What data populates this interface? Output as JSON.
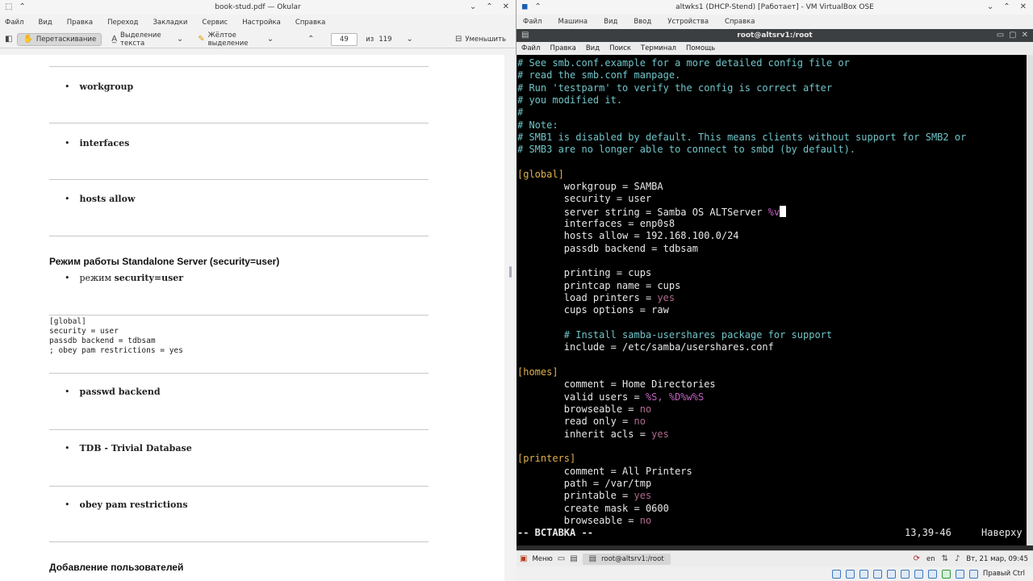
{
  "okular": {
    "title": "book-stud.pdf — Okular",
    "menu": [
      "Файл",
      "Вид",
      "Правка",
      "Переход",
      "Закладки",
      "Сервис",
      "Настройка",
      "Справка"
    ],
    "toolbar": {
      "drag": "Перетаскивание",
      "text_select": "Выделение текста",
      "highlight": "Жёлтое выделение",
      "page": "49",
      "of": "из",
      "total": "119",
      "zoom_out": "Уменьшить"
    },
    "doc": {
      "b_workgroup": "workgroup",
      "b_interfaces": "interfaces",
      "b_hosts": "hosts allow",
      "heading1": "Режим работы Standalone Server (security=user)",
      "b_mode_prefix": "режим",
      "b_mode_bold": "security=user",
      "code": [
        "[global]",
        "security = user",
        "passdb backend = tdbsam",
        "; obey pam restrictions = yes"
      ],
      "b_passwd": "passwd backend",
      "b_tdb": "TDB - Trivial Database",
      "b_obey": "obey pam restrictions",
      "heading2": "Добавление пользователей"
    }
  },
  "vbox": {
    "title": "altwks1 (DHCP-Stend) [Работает] - VM VirtualBox OSE",
    "menu": [
      "Файл",
      "Машина",
      "Вид",
      "Ввод",
      "Устройства",
      "Справка"
    ],
    "konsole_title": "root@altsrv1:/root",
    "konsole_menu": [
      "Файл",
      "Правка",
      "Вид",
      "Поиск",
      "Терминал",
      "Помощь"
    ],
    "term": {
      "l0": "# See smb.conf.example for a more detailed config file or",
      "l1": "# read the smb.conf manpage.",
      "l2": "# Run 'testparm' to verify the config is correct after",
      "l3": "# you modified it.",
      "l4": "#",
      "l5": "# Note:",
      "l6": "# SMB1 is disabled by default. This means clients without support for SMB2 or",
      "l7": "# SMB3 are no longer able to connect to smbd (by default).",
      "s_global": "[global]",
      "workgroup": "        workgroup = SAMBA",
      "security": "        security = user",
      "server_string": "        server string = Samba OS ALTServer ",
      "server_pct": "%v",
      "interfaces": "        interfaces = enp0s8",
      "hosts_allow": "        hosts allow = 192.168.100.0/24",
      "passdb": "        passdb backend = tdbsam",
      "printing": "        printing = cups",
      "printcap": "        printcap name = cups",
      "load_printers": "        load printers = ",
      "yes": "yes",
      "no": "no",
      "cups_options": "        cups options = raw",
      "install_comment": "        # Install samba-usershares package for support",
      "include": "        include = /etc/samba/usershares.conf",
      "s_homes": "[homes]",
      "comment_home": "        comment = Home Directories",
      "valid_users": "        valid users = ",
      "valid_users_val": "%S, %D%w%S",
      "browseable": "        browseable = ",
      "read_only": "        read only = ",
      "inherit_acls": "        inherit acls = ",
      "s_printers": "[printers]",
      "comment_printers": "        comment = All Printers",
      "path": "        path = /var/tmp",
      "printable": "        printable = ",
      "create_mask": "        create mask = 0600",
      "browseable2": "        browseable = "
    },
    "status_mode": "-- ВСТАВКА --",
    "status_pos": "13,39-46",
    "status_where": "Наверху",
    "taskbar": {
      "start": "Меню",
      "task": "root@altsrv1:/root",
      "lang": "en",
      "clock": "Вт, 21 мар, 09:45"
    },
    "host_ctrl": "Правый Ctrl"
  }
}
